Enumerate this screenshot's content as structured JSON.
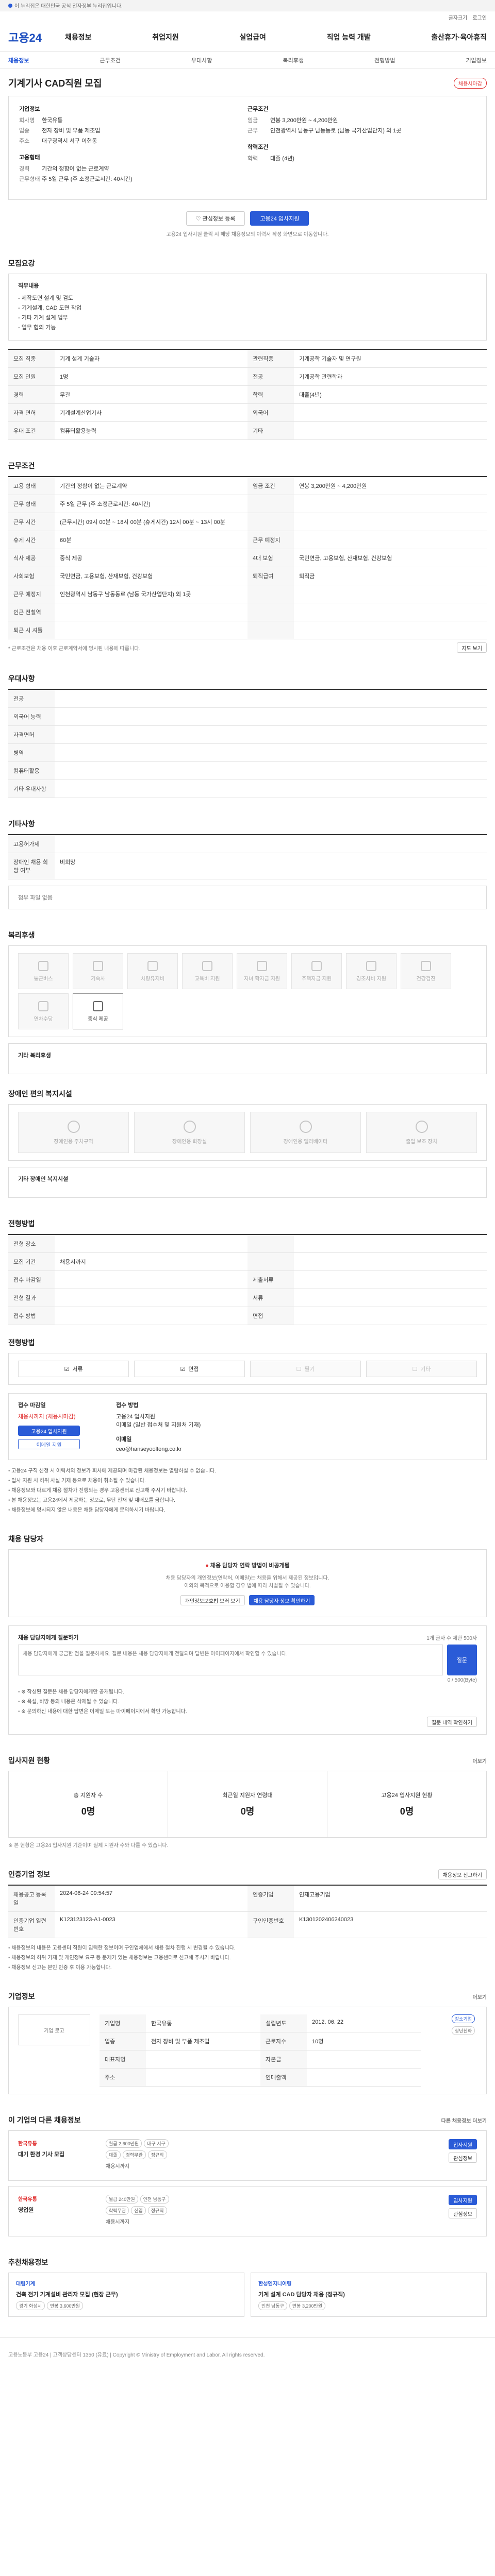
{
  "banner": {
    "text": "이 누리집은 대한민국 공식 전자정부 누리집입니다."
  },
  "util": {
    "font": "글자크기",
    "login": "로그인"
  },
  "logo": "고용24",
  "gnb": [
    "채용정보",
    "취업지원",
    "실업급여",
    "직업 능력 개발",
    "출산휴가·육아휴직"
  ],
  "lnb": {
    "items": [
      "채용정보",
      "근무조건",
      "우대사항",
      "복리후생",
      "전형방법",
      "기업정보"
    ],
    "active": 0
  },
  "job": {
    "title": "기계기사 CAD직원 모집",
    "status": "채용시마감",
    "company_head": "기업정보",
    "company_rows": [
      {
        "l": "회사명",
        "v": "한국유통"
      },
      {
        "l": "업종",
        "v": "전자 장비 및 부품 제조업"
      },
      {
        "l": "주소",
        "v": "대구광역시 서구 이현동"
      }
    ],
    "terms_head": "근무조건",
    "terms_rows": [
      {
        "l": "임금",
        "v": "연봉 3,200만원 ~ 4,200만원"
      },
      {
        "l": "근무",
        "v": "인천광역시 남동구 남동동로 (남동 국가산업단지) 외 1곳"
      }
    ],
    "edu_head": "고용형태",
    "edu_rows": [
      {
        "l": "경력",
        "v": "기간의 정함이 없는 근로계약"
      },
      {
        "l": "근무형태",
        "v": "주 5일 근무 (주 소정근로시간: 40시간)"
      }
    ],
    "career_head": "학력조건",
    "career_rows": [
      {
        "l": "학력",
        "v": "대졸 (4년)"
      }
    ],
    "btn_save": "관심정보 등록",
    "btn_apply": "고용24 입사지원",
    "apply_note": "고용24 입사지원 클릭 시 해당 채용정보의 이력서 작성 화면으로 이동합니다."
  },
  "recruit": {
    "heading": "모집요강",
    "desc_head": "직무내용",
    "desc": [
      "- 제작도면 설계 및 검토",
      "- 기계설계, CAD 도면 작업",
      "- 기타 기계 설계 업무",
      "- 업무 협의 가능"
    ],
    "rows": [
      {
        "th": "모집 직종",
        "td": "기계 설계 기술자",
        "th2": "관련직종",
        "td2": "기계공학 기술자 및 연구원"
      },
      {
        "th": "모집 인원",
        "td": "1명",
        "th2": "전공",
        "td2": "기계공학 관련학과"
      },
      {
        "th": "경력",
        "td": "무관",
        "th2": "학력",
        "td2": "대졸(4년)"
      },
      {
        "th": "자격 면허",
        "td": "기계설계산업기사",
        "th2": "외국어",
        "td2": ""
      },
      {
        "th": "우대 조건",
        "td": "컴퓨터활용능력",
        "th2": "기타",
        "td2": ""
      }
    ],
    "req_head": "요구 경력"
  },
  "work": {
    "heading": "근무조건",
    "rows": [
      {
        "th": "고용 형태",
        "td": "기간의 정함이 없는 근로계약",
        "th2": "임금 조건",
        "td2": "연봉 3,200만원 ~ 4,200만원"
      },
      {
        "th": "근무 형태",
        "td": "주 5일 근무 (주 소정근로시간: 40시간)",
        "th2": "",
        "td2": ""
      },
      {
        "th": "근무 시간",
        "td": "(근무시간) 09시 00분 ~ 18시 00분 (휴게시간) 12시 00분 ~ 13시 00분",
        "th2": "",
        "td2": ""
      },
      {
        "th": "휴게 시간",
        "td": "60분",
        "th2": "근무 예정지",
        "td2": ""
      },
      {
        "th": "식사 제공",
        "td": "중식 제공",
        "th2": "4대 보험",
        "td2": "국민연금, 고용보험, 산재보험, 건강보험"
      },
      {
        "th": "사회보험",
        "td": "국민연금, 고용보험, 산재보험, 건강보험",
        "th2": "퇴직급여",
        "td2": "퇴직금"
      },
      {
        "th": "근무 예정지",
        "td": "인천광역시 남동구 남동동로 (남동 국가산업단지) 외 1곳",
        "th2": "",
        "td2": ""
      },
      {
        "th": "인근 전철역",
        "td": "",
        "th2": "",
        "td2": ""
      },
      {
        "th": "퇴근 시 셔틀",
        "td": "",
        "th2": "",
        "td2": ""
      }
    ],
    "map_btn": "지도 보기",
    "note": "* 근로조건은 채용 이후 근로계약서에 명시된 내용에 따릅니다."
  },
  "pref": {
    "heading": "우대사항",
    "rows": [
      {
        "th": "전공",
        "td": ""
      },
      {
        "th": "외국어 능력",
        "td": ""
      },
      {
        "th": "자격면허",
        "td": ""
      },
      {
        "th": "병역",
        "td": ""
      },
      {
        "th": "컴퓨터활용",
        "td": ""
      },
      {
        "th": "기타 우대사항",
        "td": ""
      }
    ]
  },
  "etc": {
    "heading": "기타사항",
    "rows": [
      {
        "th": "고용허가제",
        "td": ""
      },
      {
        "th": "장애인 채용 희망 여부",
        "td": "비희망"
      }
    ],
    "attach": "첨부 파일 없음"
  },
  "welfare": {
    "heading": "복리후생",
    "items": [
      {
        "name": "통근버스",
        "on": false
      },
      {
        "name": "기숙사",
        "on": false
      },
      {
        "name": "차량유지비",
        "on": false
      },
      {
        "name": "교육비 지원",
        "on": false
      },
      {
        "name": "자녀 학자금 지원",
        "on": false
      },
      {
        "name": "주택자금 지원",
        "on": false
      },
      {
        "name": "경조사비 지원",
        "on": false
      },
      {
        "name": "건강검진",
        "on": false
      },
      {
        "name": "연차수당",
        "on": false
      },
      {
        "name": "중식 제공",
        "on": true
      }
    ],
    "etc_head": "기타 복리후생",
    "disab_head": "장애인 편의 복지시설",
    "disab_items": [
      "장애인용 주차구역",
      "장애인용 화장실",
      "장애인용 엘리베이터",
      "출입 보조 장치"
    ],
    "disab_etc": "기타 장애인 복지시설"
  },
  "process": {
    "heading": "전형방법",
    "rows": [
      {
        "th": "전형 장소",
        "td": "",
        "th2": "",
        "td2": ""
      },
      {
        "th": "모집 기간",
        "td": "채용시까지",
        "th2": "",
        "td2": ""
      },
      {
        "th": "접수 마감일",
        "td": "",
        "th2": "제출서류",
        "td2": ""
      },
      {
        "th": "전형 결과",
        "td": "",
        "th2": "서류",
        "td2": ""
      },
      {
        "th": "접수 방법",
        "td": "",
        "th2": "면접",
        "td2": ""
      }
    ],
    "methods_head": "전형방법",
    "methods": [
      {
        "name": "서류",
        "on": true
      },
      {
        "name": "면접",
        "on": true
      },
      {
        "name": "필기",
        "on": false
      },
      {
        "name": "기타",
        "on": false
      }
    ],
    "apply_head": "접수 마감일",
    "apply_deadline": "채용시까지 (채용시마감)",
    "apply_btn": "고용24 입사지원",
    "apply_btn2": "이메일 지원",
    "method_head": "접수 방법",
    "method_desc": "고용24 입사지원\n이메일 (일반 접수처 및 지원처 기재)",
    "contact_head": "이메일",
    "contact_email": "ceo@hanseyooltong.co.kr",
    "notes": [
      "고용24 구직 신청 시 이력서의 정보가 회사에 제공되며 마감된 채용정보는 열람하실 수 없습니다.",
      "입사 지원 시 허위 사실 기재 등으로 채용이 취소될 수 있습니다.",
      "채용정보와 다르게 채용 절차가 진행되는 경우 고용센터로 신고해 주시기 바랍니다.",
      "본 채용정보는 고용24에서 제공하는 정보로, 무단 전재 및 재배포를 금합니다.",
      "채용정보에 명시되지 않은 내용은 채용 담당자에게 문의하시기 바랍니다."
    ]
  },
  "manager": {
    "heading": "채용 담당자",
    "alert_title": "채용 담당자 연락 방법이 비공개됨",
    "alert_text": "채용 담당자의 개인정보(연락처, 이메일)는 채용을 위해서 제공된 정보입니다.\n이외의 목적으로 이용할 경우 법에 따라 처벌될 수 있습니다.",
    "btn1": "개인정보보호법 보러 보기",
    "btn2": "채용 담당자 정보 확인하기",
    "ask_head": "채용 담당자에게 질문하기",
    "ask_hint": "1개 글자 수 제한 500자",
    "ask_placeholder": "채용 담당자에게 궁금한 점을 질문하세요. 질문 내용은 채용 담당자에게 전달되며 답변은 마이페이지에서 확인할 수 있습니다.",
    "ask_count": "0 / 500(Byte)",
    "ask_btn": "질문",
    "ask_notes": [
      "※ 작성된 질문은 채용 담당자에게만 공개됩니다.",
      "※ 욕설, 비방 등의 내용은 삭제될 수 있습니다.",
      "※ 문의하신 내용에 대한 답변은 이메일 또는 마이페이지에서 확인 가능합니다."
    ],
    "ask_check_btn": "질문 내역 확인하기"
  },
  "interest": {
    "heading": "입사지원 현황",
    "more": "더보기",
    "cols": [
      {
        "label": "총 지원자 수",
        "value": "0명"
      },
      {
        "label": "최근일 지원자 연령대",
        "value": "0명"
      },
      {
        "label": "고용24 입사지원 현황",
        "value": "0명"
      }
    ],
    "note": "※ 본 현황은 고용24 입사지원 기준이며 실제 지원자 수와 다를 수 있습니다."
  },
  "info": {
    "heading": "인증기업 정보",
    "btn": "채용정보 신고하기",
    "rows": [
      {
        "th": "채용공고 등록일",
        "td": "2024-06-24 09:54:57",
        "th2": "인증기업",
        "td2": "인재고용기업"
      },
      {
        "th": "인증기업 일련번호",
        "td": "K123123123-A1-0023",
        "th2": "구인인증번호",
        "td2": "K1301202406240023"
      }
    ],
    "notes": [
      "채용정보의 내용은 고용센터 직원이 입력한 정보이며 구인업체에서 채용 절차 진행 시 변경될 수 있습니다.",
      "채용정보의 허위 기재 및 개인정보 요구 등 문제가 있는 채용정보는 고용센터로 신고해 주시기 바랍니다.",
      "채용정보 신고는 본인 인증 후 이용 가능합니다."
    ]
  },
  "company": {
    "heading": "기업정보",
    "more": "더보기",
    "logo_alt": "기업 로고",
    "rows": [
      {
        "th": "기업명",
        "td": "한국유통",
        "th2": "설립년도",
        "td2": "2012. 06. 22"
      },
      {
        "th": "업종",
        "td": "전자 장비 및 부품 제조업",
        "th2": "근로자수",
        "td2": "10명"
      },
      {
        "th": "대표자명",
        "td": "",
        "th2": "자본금",
        "td2": ""
      },
      {
        "th": "주소",
        "td": "",
        "th2": "연매출액",
        "td2": ""
      }
    ],
    "tag1": "강소기업",
    "tag2": "청년친화"
  },
  "related": {
    "heading": "이 기업의 다른 채용정보",
    "more": "다른 채용정보 더보기",
    "jobs": [
      {
        "co": "한국유통",
        "title": "대기 환경 기사 모집",
        "pay": "월급 2,600만원",
        "loc": "대구 서구",
        "edu": "대졸",
        "career": "경력무관",
        "type": "정규직",
        "close": "채용시까지",
        "btn1": "입사지원",
        "btn2": "관심정보"
      },
      {
        "co": "한국유통",
        "title": "영업원",
        "pay": "월급 240만원",
        "loc": "인천 남동구",
        "edu": "학력무관",
        "career": "신입",
        "type": "정규직",
        "close": "채용시까지",
        "btn1": "입사지원",
        "btn2": "관심정보"
      }
    ]
  },
  "recommend": {
    "heading": "추천채용정보",
    "cards": [
      {
        "co": "대림기계",
        "title": "건축 전기 기계설비 관리자 모집 (현장 근무)",
        "loc": "경기 화성시",
        "pay": "연봉 3,600만원"
      },
      {
        "co": "한성엔지니어링",
        "title": "기계 설계 CAD 담당자 채용 (정규직)",
        "loc": "인천 남동구",
        "pay": "연봉 3,200만원"
      }
    ]
  },
  "footer": {
    "text": "고용노동부 고용24 | 고객상담센터 1350 (유료) | Copyright © Ministry of Employment and Labor. All rights reserved."
  }
}
